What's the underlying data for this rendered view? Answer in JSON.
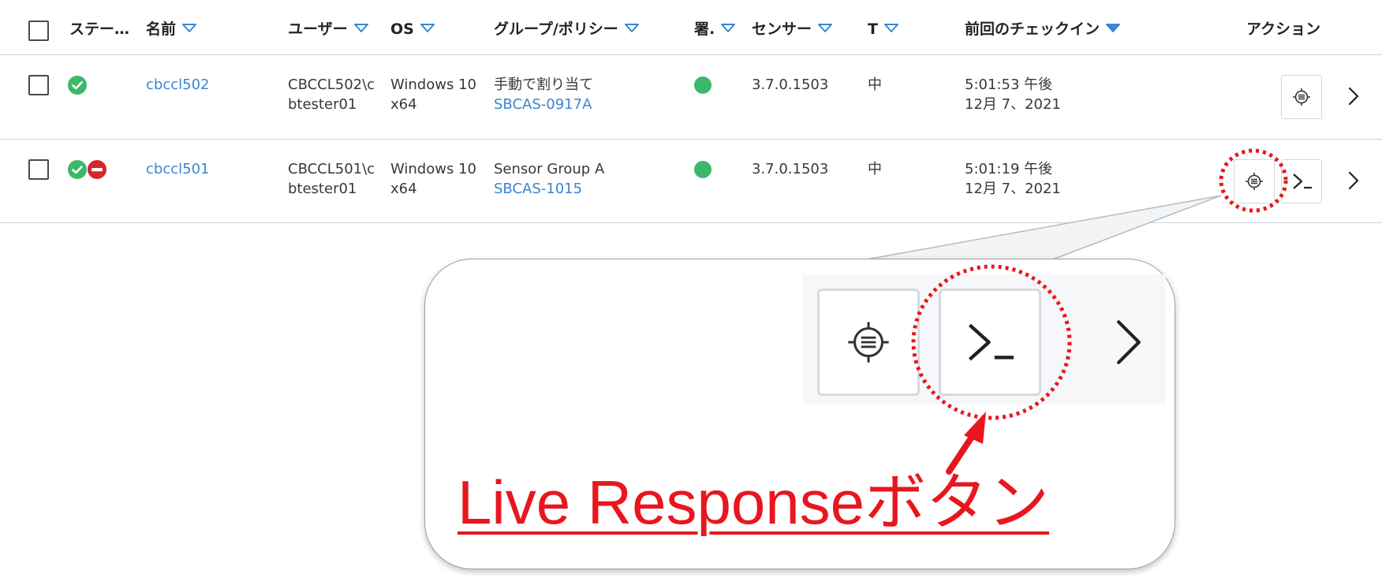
{
  "table": {
    "headers": {
      "status": "ステー…",
      "name": "名前",
      "user": "ユーザー",
      "os": "OS",
      "group_policy": "グループ/ポリシー",
      "signature": "署.",
      "sensor": "センサー",
      "target": "T",
      "last_checkin": "前回のチェックイン",
      "actions": "アクション"
    },
    "rows": [
      {
        "name": "cbccl502",
        "user_line1": "CBCCL502\\c",
        "user_line2": "btester01",
        "os_line1": "Windows 10",
        "os_line2": "x64",
        "group": "手動で割り当て",
        "policy": "SBCAS-0917A",
        "sensor": "3.7.0.1503",
        "target": "中",
        "checkin_time": "5:01:53 午後",
        "checkin_date": "12月 7、2021"
      },
      {
        "name": "cbccl501",
        "user_line1": "CBCCL501\\c",
        "user_line2": "btester01",
        "os_line1": "Windows 10",
        "os_line2": "x64",
        "group": "Sensor Group A",
        "policy": "SBCAS-1015",
        "sensor": "3.7.0.1503",
        "target": "中",
        "checkin_time": "5:01:19 午後",
        "checkin_date": "12月 7、2021"
      }
    ]
  },
  "callout": {
    "caption": "Live Responseボタン"
  },
  "colors": {
    "accent_link": "#3a86d1",
    "status_ok": "#3cb86a",
    "status_blocked": "#d8242c",
    "annotation_red": "#e8161e",
    "sort_arrow": "#3a86d1"
  },
  "icons": {
    "status_ok": "check-circle-icon",
    "status_blocked": "minus-circle-icon",
    "action_device": "crosshair-list-icon",
    "action_live_response": "terminal-prompt-icon",
    "row_detail": "chevron-right-icon",
    "filter": "triangle-down-outline-icon",
    "sort": "triangle-down-filled-icon"
  }
}
